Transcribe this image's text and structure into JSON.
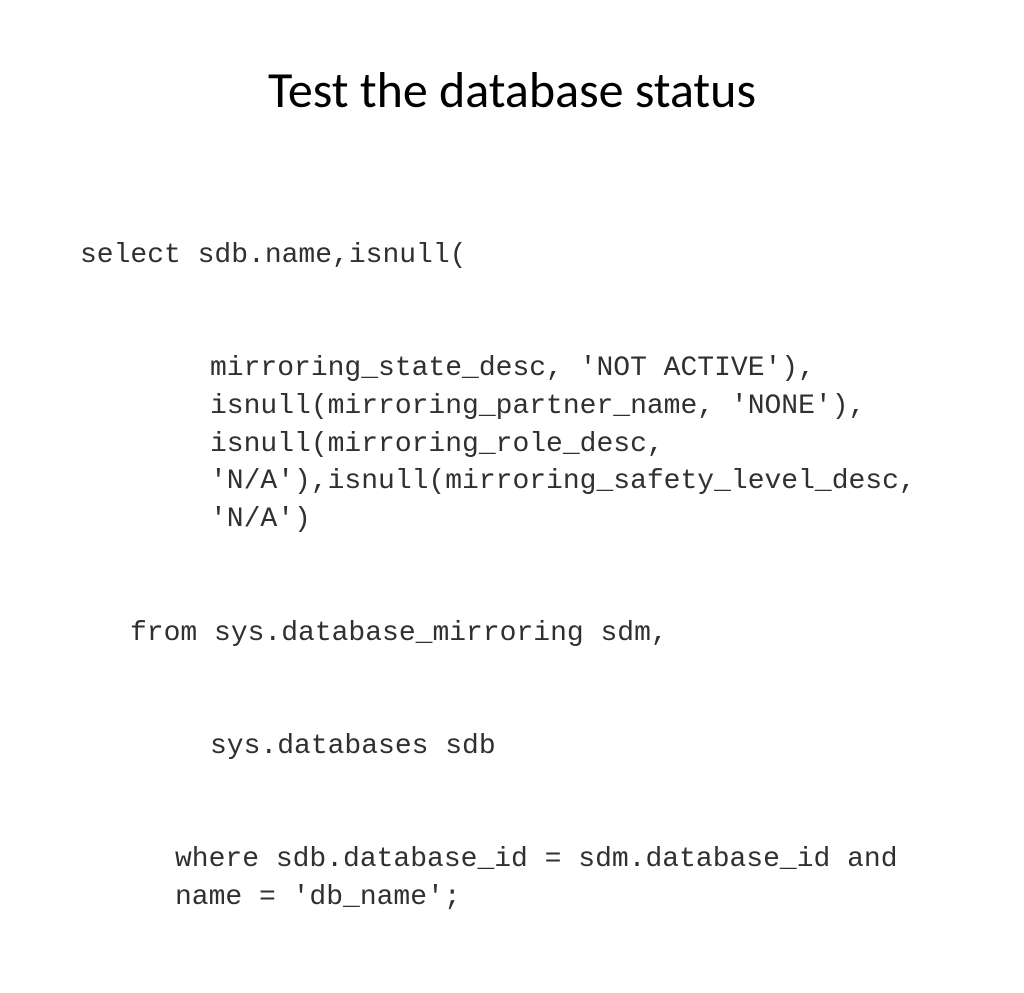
{
  "slide": {
    "title": "Test the database status",
    "code": {
      "line1": "select sdb.name,isnull(",
      "line2": "mirroring_state_desc, 'NOT ACTIVE'), isnull(mirroring_partner_name, 'NONE'), isnull(mirroring_role_desc, 'N/A'),isnull(mirroring_safety_level_desc, 'N/A')",
      "line3": "from sys.database_mirroring sdm,",
      "line4": "sys.databases sdb",
      "line5": "where sdb.database_id = sdm.database_id and name = 'db_name';"
    }
  }
}
